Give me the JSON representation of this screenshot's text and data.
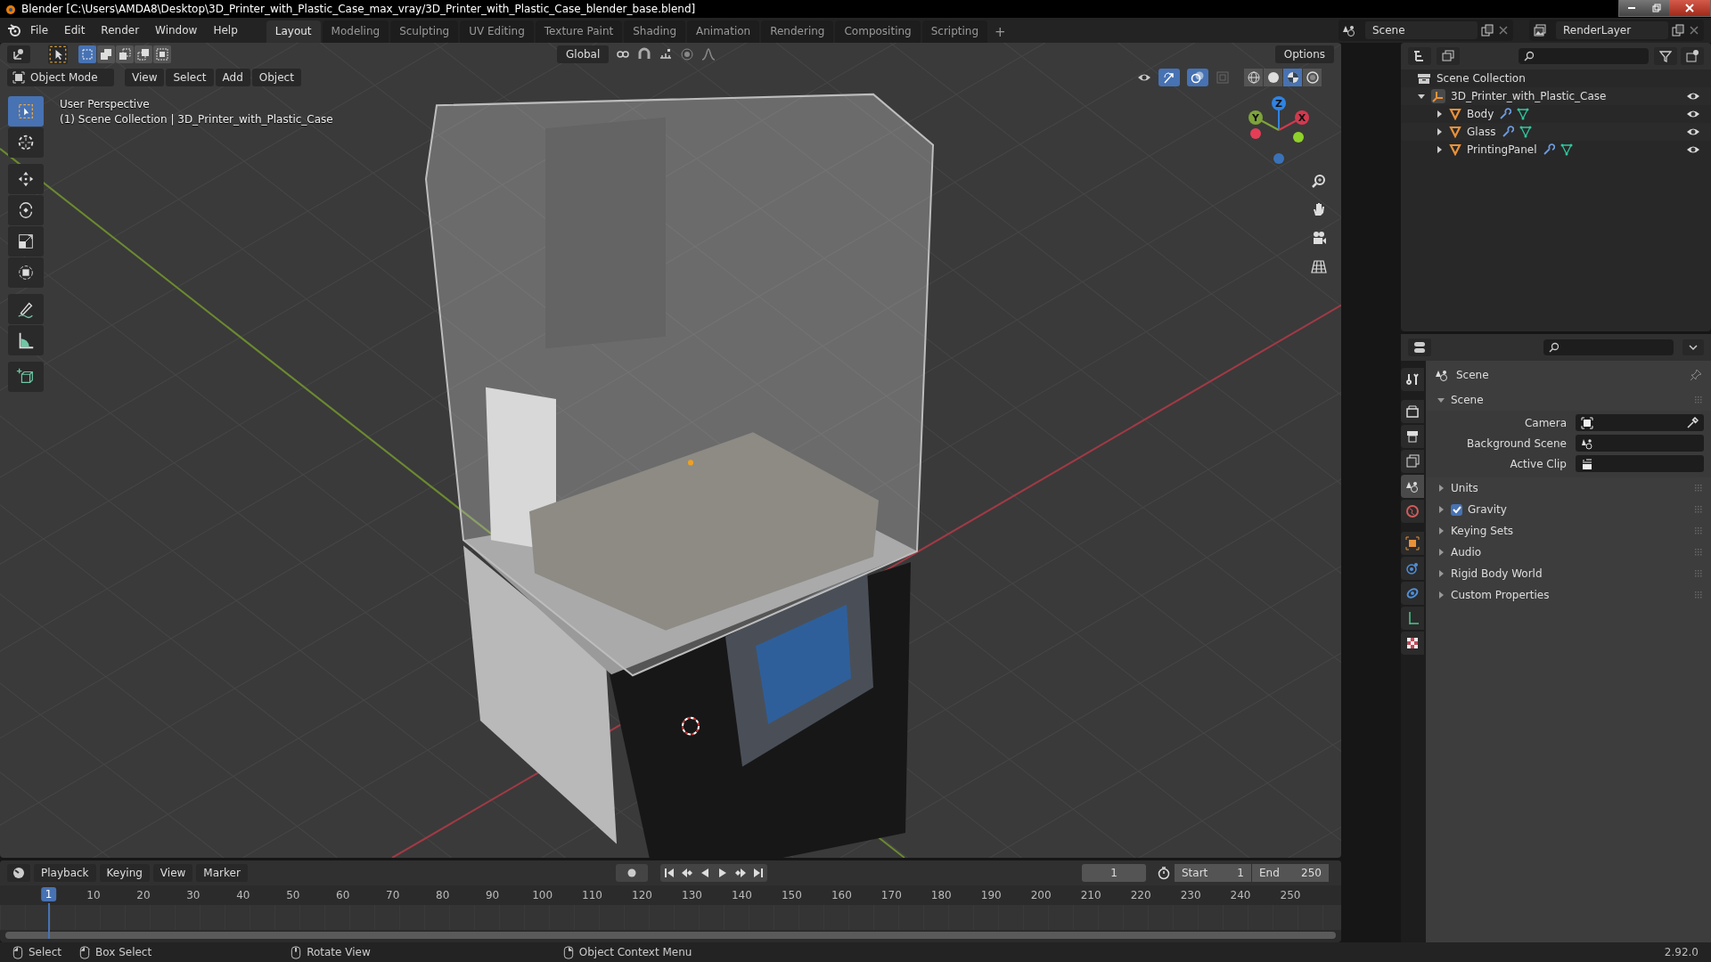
{
  "window": {
    "title": "Blender [C:\\Users\\AMDA8\\Desktop\\3D_Printer_with_Plastic_Case_max_vray/3D_Printer_with_Plastic_Case_blender_base.blend]"
  },
  "menu": [
    "File",
    "Edit",
    "Render",
    "Window",
    "Help"
  ],
  "workspaces": [
    {
      "label": "Layout",
      "selected": true
    },
    {
      "label": "Modeling",
      "selected": false
    },
    {
      "label": "Sculpting",
      "selected": false
    },
    {
      "label": "UV Editing",
      "selected": false
    },
    {
      "label": "Texture Paint",
      "selected": false
    },
    {
      "label": "Shading",
      "selected": false
    },
    {
      "label": "Animation",
      "selected": false
    },
    {
      "label": "Rendering",
      "selected": false
    },
    {
      "label": "Compositing",
      "selected": false
    },
    {
      "label": "Scripting",
      "selected": false
    }
  ],
  "add_workspace": "+",
  "scene_selector": {
    "value": "Scene"
  },
  "view_layer_selector": {
    "value": "RenderLayer"
  },
  "tool_header": {
    "select_modes": [
      {
        "kind": "set",
        "selected": true
      },
      {
        "kind": "extend",
        "selected": false
      },
      {
        "kind": "subtract",
        "selected": false
      },
      {
        "kind": "invert",
        "selected": false
      },
      {
        "kind": "intersect",
        "selected": false
      }
    ],
    "orientation": "Global",
    "options": "Options"
  },
  "viewport_header": {
    "mode": "Object Mode",
    "menus": [
      "View",
      "Select",
      "Add",
      "Object"
    ],
    "gizmos_on": true,
    "overlays_on": true,
    "shading": [
      {
        "kind": "wireframe",
        "selected": false
      },
      {
        "kind": "solid",
        "selected": false
      },
      {
        "kind": "material",
        "selected": true
      },
      {
        "kind": "rendered",
        "selected": false
      }
    ]
  },
  "viewport": {
    "perspective": "User Perspective",
    "collection_info": "(1) Scene Collection | 3D_Printer_with_Plastic_Case",
    "axes": [
      {
        "label": "Z",
        "color": "#2f83e3"
      },
      {
        "label": "Y",
        "color": "#7ea33a"
      },
      {
        "label": "X",
        "color": "#d3394f"
      }
    ]
  },
  "toolbar": [
    {
      "kind": "select-box",
      "selected": true
    },
    {
      "kind": "cursor",
      "selected": false
    },
    {
      "kind": "move",
      "selected": false
    },
    {
      "kind": "rotate",
      "selected": false
    },
    {
      "kind": "scale",
      "selected": false
    },
    {
      "kind": "transform",
      "selected": false
    },
    {
      "kind": "annotate",
      "selected": false
    },
    {
      "kind": "measure",
      "selected": false
    },
    {
      "kind": "add-cube",
      "selected": false
    }
  ],
  "outliner": {
    "root": "Scene Collection",
    "items": [
      {
        "name": "3D_Printer_with_Plastic_Case",
        "kind": "empty",
        "expanded": true,
        "visible": true,
        "children": [
          {
            "name": "Body",
            "kind": "mesh",
            "expanded": false,
            "visible": true
          },
          {
            "name": "Glass",
            "kind": "mesh",
            "expanded": false,
            "visible": true
          },
          {
            "name": "PrintingPanel",
            "kind": "mesh",
            "expanded": false,
            "visible": true
          }
        ]
      }
    ]
  },
  "properties": {
    "tabs": [
      {
        "kind": "tool",
        "selected": false
      },
      {
        "kind": "render",
        "selected": false
      },
      {
        "kind": "output",
        "selected": false
      },
      {
        "kind": "view-layer",
        "selected": false
      },
      {
        "kind": "scene",
        "selected": true
      },
      {
        "kind": "world",
        "selected": false
      },
      {
        "kind": "object",
        "selected": false
      },
      {
        "kind": "physics",
        "selected": false
      },
      {
        "kind": "constraints",
        "selected": false
      },
      {
        "kind": "data",
        "selected": false
      },
      {
        "kind": "texture",
        "selected": false
      }
    ],
    "context": "Scene",
    "panels": [
      {
        "title": "Scene",
        "expanded": true,
        "fields": [
          {
            "label": "Camera",
            "kind": "camera"
          },
          {
            "label": "Background Scene",
            "kind": "scene"
          },
          {
            "label": "Active Clip",
            "kind": "clip"
          }
        ]
      },
      {
        "title": "Units",
        "expanded": false
      },
      {
        "title": "Gravity",
        "expanded": false,
        "toggle": {
          "checked": true
        }
      },
      {
        "title": "Keying Sets",
        "expanded": false
      },
      {
        "title": "Audio",
        "expanded": false
      },
      {
        "title": "Rigid Body World",
        "expanded": false
      },
      {
        "title": "Custom Properties",
        "expanded": false
      }
    ]
  },
  "timeline": {
    "menus": [
      "Playback",
      "Keying",
      "View",
      "Marker"
    ],
    "current_frame": "1",
    "playhead": "1",
    "start_label": "Start",
    "start": "1",
    "end_label": "End",
    "end": "250",
    "ruler": [
      "10",
      "20",
      "30",
      "40",
      "50",
      "60",
      "70",
      "80",
      "90",
      "100",
      "110",
      "120",
      "130",
      "140",
      "150",
      "160",
      "170",
      "180",
      "190",
      "200",
      "210",
      "220",
      "230",
      "240",
      "250"
    ]
  },
  "status_bar": {
    "hints": [
      {
        "label": "Select",
        "kind": "left"
      },
      {
        "label": "Box Select",
        "kind": "drag"
      },
      {
        "label": "Rotate View",
        "kind": "middle"
      },
      {
        "label": "Object Context Menu",
        "kind": "right"
      }
    ],
    "version": "2.92.0"
  }
}
